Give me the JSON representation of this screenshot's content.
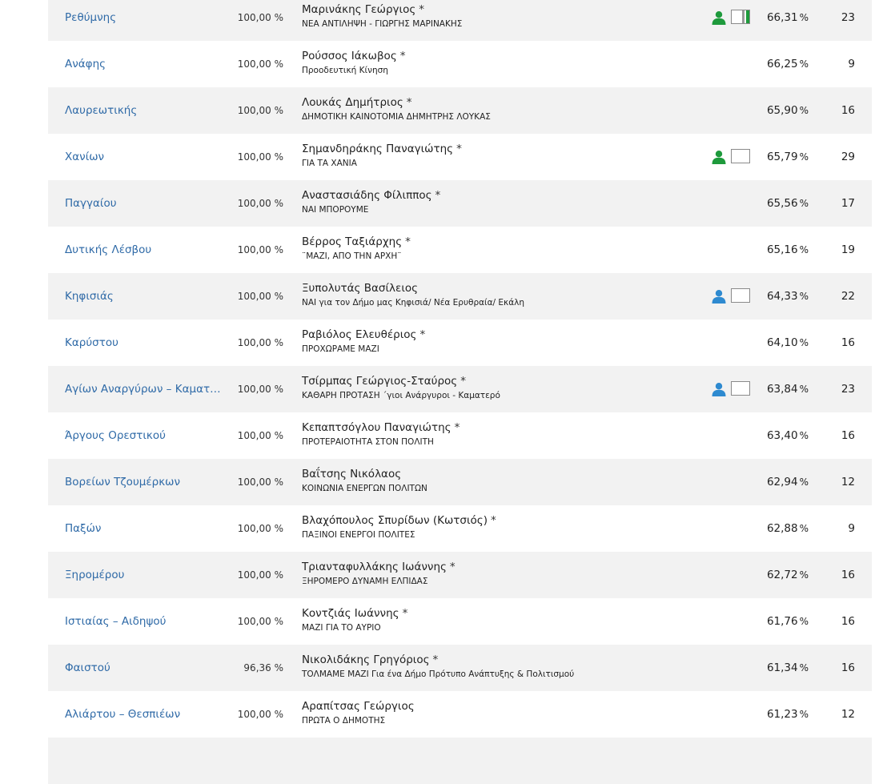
{
  "percent_suffix": "%",
  "colors": {
    "winner_green": "#1e9a3c",
    "person_blue": "#2e8ad0",
    "link_blue": "#2f6aa7",
    "row_shade": "#f2f2f2"
  },
  "rows": [
    {
      "municipality": "Ρεθύμνης",
      "counted": "100,00 %",
      "candidate": "Μαρινάκης Γεώργιος",
      "starred": true,
      "party": "ΝΕΑ ΑΝΤΙΛΗΨΗ - ΓΙΩΡΓΗΣ ΜΑΡΙΝΑΚΗΣ",
      "person_icon": "green",
      "flag": "green-stripe",
      "percent": "66,31",
      "seats": "23"
    },
    {
      "municipality": "Ανάφης",
      "counted": "100,00 %",
      "candidate": "Ρούσσος Ιάκωβος",
      "starred": true,
      "party": "Προοδευτική Κίνηση",
      "person_icon": "",
      "flag": "",
      "percent": "66,25",
      "seats": "9"
    },
    {
      "municipality": "Λαυρεωτικής",
      "counted": "100,00 %",
      "candidate": "Λουκάς Δημήτριος",
      "starred": true,
      "party": "ΔΗΜΟΤΙΚΗ ΚΑΙΝΟΤΟΜΙΑ ΔΗΜΗΤΡΗΣ ΛΟΥΚΑΣ",
      "person_icon": "",
      "flag": "",
      "percent": "65,90",
      "seats": "16"
    },
    {
      "municipality": "Χανίων",
      "counted": "100,00 %",
      "candidate": "Σημανδηράκης Παναγιώτης",
      "starred": true,
      "party": "ΓΙΑ ΤΑ ΧΑΝΙΑ",
      "person_icon": "green",
      "flag": "blank",
      "percent": "65,79",
      "seats": "29"
    },
    {
      "municipality": "Παγγαίου",
      "counted": "100,00 %",
      "candidate": "Αναστασιάδης Φίλιππος",
      "starred": true,
      "party": "ΝΑΙ ΜΠΟΡΟΥΜΕ",
      "person_icon": "",
      "flag": "",
      "percent": "65,56",
      "seats": "17"
    },
    {
      "municipality": "Δυτικής Λέσβου",
      "counted": "100,00 %",
      "candidate": "Βέρρος Ταξιάρχης",
      "starred": true,
      "party": "¨ΜΑΖΙ, ΑΠΟ ΤΗΝ ΑΡΧΗ¨",
      "person_icon": "",
      "flag": "",
      "percent": "65,16",
      "seats": "19"
    },
    {
      "municipality": "Κηφισιάς",
      "counted": "100,00 %",
      "candidate": "Ξυπολυτάς Βασίλειος",
      "starred": false,
      "party": "ΝΑΙ για τον Δήμο μας Κηφισιά/ Νέα Ερυθραία/ Εκάλη",
      "person_icon": "blue",
      "flag": "blank",
      "percent": "64,33",
      "seats": "22"
    },
    {
      "municipality": "Καρύστου",
      "counted": "100,00 %",
      "candidate": "Ραβιόλος Ελευθέριος",
      "starred": true,
      "party": "ΠΡΟΧΩΡΑΜΕ ΜΑΖΙ",
      "person_icon": "",
      "flag": "",
      "percent": "64,10",
      "seats": "16"
    },
    {
      "municipality": "Αγίων Αναργύρων – Καματερού",
      "counted": "100,00 %",
      "candidate": "Τσίρμπας Γεώργιος-Σταύρος",
      "starred": true,
      "party": "ΚΑΘΑΡΗ ΠΡΟΤΑΣΗ ΄γιοι Ανάργυροι - Καματερό",
      "person_icon": "blue",
      "flag": "blank",
      "percent": "63,84",
      "seats": "23"
    },
    {
      "municipality": "Άργους Ορεστικού",
      "counted": "100,00 %",
      "candidate": "Κεπαπτσόγλου Παναγιώτης",
      "starred": true,
      "party": "ΠΡΟΤΕΡΑΙΟΤΗΤΑ ΣΤΟΝ ΠΟΛΙΤΗ",
      "person_icon": "",
      "flag": "",
      "percent": "63,40",
      "seats": "16"
    },
    {
      "municipality": "Βορείων Τζουμέρκων",
      "counted": "100,00 %",
      "candidate": "Βαΐτσης Νικόλαος",
      "starred": false,
      "party": "ΚΟΙΝΩΝΙΑ ΕΝΕΡΓΩΝ ΠΟΛΙΤΩΝ",
      "person_icon": "",
      "flag": "",
      "percent": "62,94",
      "seats": "12"
    },
    {
      "municipality": "Παξών",
      "counted": "100,00 %",
      "candidate": "Βλαχόπουλος Σπυρίδων (Κωτσιός)",
      "starred": true,
      "party": "ΠΑΞΙΝΟΙ ΕΝΕΡΓΟΙ ΠΟΛΙΤΕΣ",
      "person_icon": "",
      "flag": "",
      "percent": "62,88",
      "seats": "9"
    },
    {
      "municipality": "Ξηρομέρου",
      "counted": "100,00 %",
      "candidate": "Τριανταφυλλάκης Ιωάννης",
      "starred": true,
      "party": "ΞΗΡΟΜΕΡΟ ΔΥΝΑΜΗ ΕΛΠΙΔΑΣ",
      "person_icon": "",
      "flag": "",
      "percent": "62,72",
      "seats": "16"
    },
    {
      "municipality": "Ιστιαίας – Αιδηψού",
      "counted": "100,00 %",
      "candidate": "Κοντζιάς Ιωάννης",
      "starred": true,
      "party": "ΜΑΖΙ ΓΙΑ ΤΟ ΑΥΡΙΟ",
      "person_icon": "",
      "flag": "",
      "percent": "61,76",
      "seats": "16"
    },
    {
      "municipality": "Φαιστού",
      "counted": "96,36 %",
      "candidate": "Νικολιδάκης Γρηγόριος",
      "starred": true,
      "party": "ΤΟΛΜΑΜΕ ΜΑΖΙ Για ένα Δήμο Πρότυπο Ανάπτυξης & Πολιτισμού",
      "person_icon": "",
      "flag": "",
      "percent": "61,34",
      "seats": "16"
    },
    {
      "municipality": "Αλιάρτου – Θεσπιέων",
      "counted": "100,00 %",
      "candidate": "Αραπίτσας Γεώργιος",
      "starred": false,
      "party": "ΠΡΩΤΑ Ο ΔΗΜΟΤΗΣ",
      "person_icon": "",
      "flag": "",
      "percent": "61,23",
      "seats": "12"
    },
    {
      "municipality": "",
      "counted": "",
      "candidate": "",
      "starred": false,
      "party": "",
      "person_icon": "",
      "flag": "",
      "percent": "",
      "seats": ""
    }
  ]
}
